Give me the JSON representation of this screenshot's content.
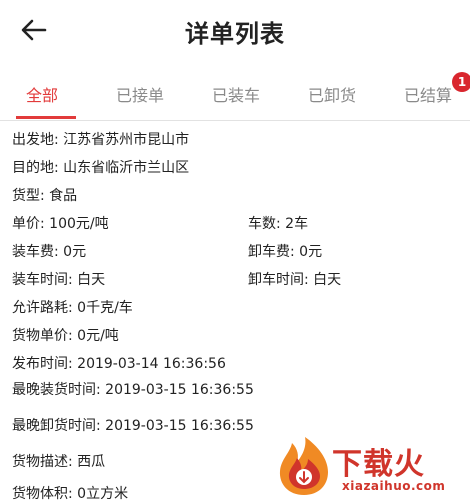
{
  "header": {
    "title": "详单列表",
    "back_icon": "arrow-left-icon"
  },
  "tabs": [
    {
      "label": "全部",
      "active": true
    },
    {
      "label": "已接单",
      "active": false
    },
    {
      "label": "已装车",
      "active": false
    },
    {
      "label": "已卸货",
      "active": false
    },
    {
      "label": "已结算",
      "active": false,
      "badge": "1"
    }
  ],
  "detail": {
    "origin": "出发地: 江苏省苏州市昆山市",
    "destination": "目的地: 山东省临沂市兰山区",
    "cargo_type": "货型: 食品",
    "unit_price": "单价: 100元/吨",
    "truck_count": "车数: 2车",
    "loading_fee": "装车费: 0元",
    "unloading_fee": "卸车费: 0元",
    "loading_time": "装车时间: 白天",
    "unloading_time": "卸车时间: 白天",
    "allowed_loss": "允许路耗: 0千克/车",
    "cargo_unit_price": "货物单价: 0元/吨",
    "publish_time": "发布时间: 2019-03-14 16:36:56",
    "latest_loading_time": "最晚装货时间: 2019-03-15 16:36:55",
    "latest_unloading_time": "最晚卸货时间: 2019-03-15 16:36:55",
    "cargo_description": "货物描述: 西瓜",
    "cargo_volume": "货物体积: 0立方米"
  },
  "watermark": {
    "text": "下载火",
    "domain": "xiazaihuo.com"
  },
  "colors": {
    "accent": "#e23b3b",
    "badge": "#d9262e",
    "tab_inactive": "#8a8a8a",
    "divider": "#e2e2e2",
    "watermark_red": "#d0352b",
    "watermark_orange": "#f08a24"
  }
}
